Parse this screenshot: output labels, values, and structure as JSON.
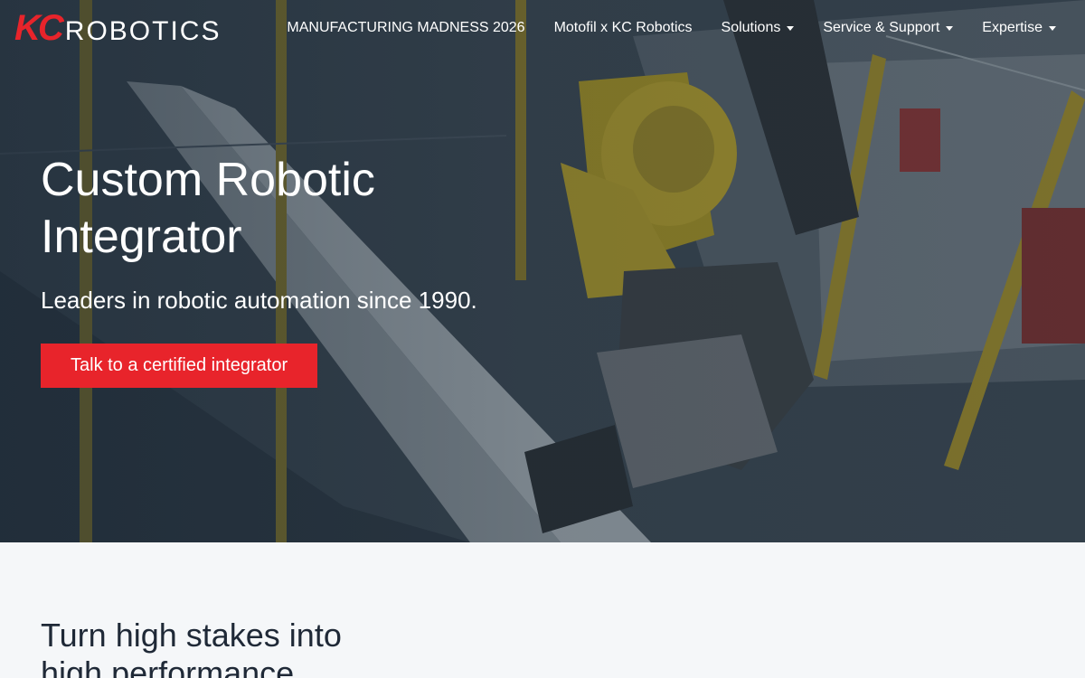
{
  "brand": {
    "logo_mark": "KC",
    "logo_word": "ROBOTICS",
    "accent_color": "#e8242b"
  },
  "nav": {
    "items": [
      {
        "label": "MANUFACTURING MADNESS 2026",
        "dropdown": false
      },
      {
        "label": "Motofil x KC Robotics",
        "dropdown": false
      },
      {
        "label": "Solutions",
        "dropdown": true
      },
      {
        "label": "Service & Support",
        "dropdown": true
      },
      {
        "label": "Expertise",
        "dropdown": true
      }
    ]
  },
  "hero": {
    "title": "Custom Robotic Integrator",
    "subtitle": "Leaders in robotic automation since 1990.",
    "cta_label": "Talk to a certified integrator"
  },
  "section": {
    "title": "Turn high stakes into high performance"
  }
}
